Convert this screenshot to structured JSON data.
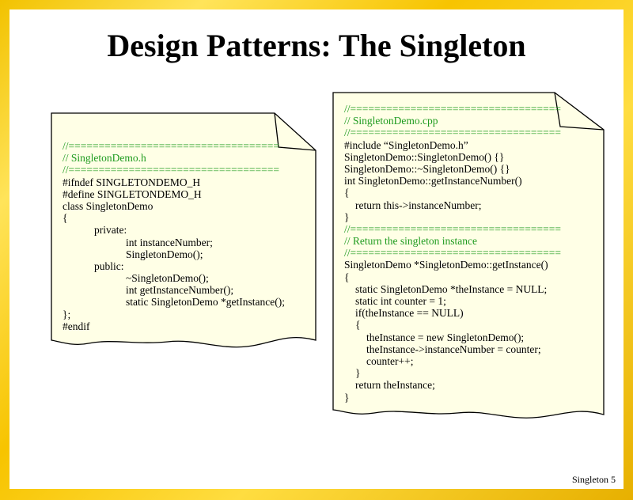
{
  "slide": {
    "title": "Design Patterns: The Singleton",
    "footer": "Singleton 5"
  },
  "header_file": {
    "lines": [
      {
        "text": "//===================================",
        "color": "green",
        "indent": 0
      },
      {
        "text": "// SingletonDemo.h",
        "color": "green",
        "indent": 0
      },
      {
        "text": "//===================================",
        "color": "green",
        "indent": 0
      },
      {
        "text": "#ifndef SINGLETONDEMO_H",
        "color": "black",
        "indent": 0
      },
      {
        "text": "#define SINGLETONDEMO_H",
        "color": "black",
        "indent": 0
      },
      {
        "text": "class SingletonDemo",
        "color": "black",
        "indent": 0
      },
      {
        "text": "{",
        "color": "black",
        "indent": 0
      },
      {
        "text": "private:",
        "color": "black",
        "indent": 1
      },
      {
        "text": "int instanceNumber;",
        "color": "black",
        "indent": 2
      },
      {
        "text": "SingletonDemo();",
        "color": "black",
        "indent": 2
      },
      {
        "text": "public:",
        "color": "black",
        "indent": 1
      },
      {
        "text": "~SingletonDemo();",
        "color": "black",
        "indent": 2
      },
      {
        "text": "int getInstanceNumber();",
        "color": "black",
        "indent": 2
      },
      {
        "text": "static SingletonDemo *getInstance();",
        "color": "black",
        "indent": 2
      },
      {
        "text": "};",
        "color": "black",
        "indent": 0
      },
      {
        "text": "#endif",
        "color": "black",
        "indent": 0
      }
    ]
  },
  "source_file": {
    "lines": [
      {
        "text": "//===================================",
        "color": "green",
        "indent": 0
      },
      {
        "text": "// SingletonDemo.cpp",
        "color": "green",
        "indent": 0
      },
      {
        "text": "//===================================",
        "color": "green",
        "indent": 0
      },
      {
        "text": "#include “SingletonDemo.h”",
        "color": "black",
        "indent": 0
      },
      {
        "text": "SingletonDemo::SingletonDemo() {}",
        "color": "black",
        "indent": 0
      },
      {
        "text": "SingletonDemo::~SingletonDemo() {}",
        "color": "black",
        "indent": 0
      },
      {
        "text": "int SingletonDemo::getInstanceNumber()",
        "color": "black",
        "indent": 0
      },
      {
        "text": "{",
        "color": "black",
        "indent": 0
      },
      {
        "text": "return this->instanceNumber;",
        "color": "black",
        "indent": 1
      },
      {
        "text": "}",
        "color": "black",
        "indent": 0
      },
      {
        "text": "//===================================",
        "color": "green",
        "indent": 0
      },
      {
        "text": "// Return the singleton instance",
        "color": "green",
        "indent": 0
      },
      {
        "text": "//===================================",
        "color": "green",
        "indent": 0
      },
      {
        "text": "SingletonDemo *SingletonDemo::getInstance()",
        "color": "black",
        "indent": 0
      },
      {
        "text": "{",
        "color": "black",
        "indent": 0
      },
      {
        "text": "static SingletonDemo *theInstance = NULL;",
        "color": "black",
        "indent": 1
      },
      {
        "text": "static int counter = 1;",
        "color": "black",
        "indent": 1
      },
      {
        "text": "if(theInstance == NULL)",
        "color": "black",
        "indent": 1
      },
      {
        "text": "{",
        "color": "black",
        "indent": 1
      },
      {
        "text": "theInstance = new SingletonDemo();",
        "color": "black",
        "indent": 2
      },
      {
        "text": "theInstance->instanceNumber = counter;",
        "color": "black",
        "indent": 2
      },
      {
        "text": "counter++;",
        "color": "black",
        "indent": 2
      },
      {
        "text": "}",
        "color": "black",
        "indent": 1
      },
      {
        "text": "return theInstance;",
        "color": "black",
        "indent": 1
      },
      {
        "text": "}",
        "color": "black",
        "indent": 0
      }
    ]
  },
  "colors": {
    "comment": "#1e9b1e",
    "note_fill": "#ffffe6",
    "border": "#d9a400"
  }
}
